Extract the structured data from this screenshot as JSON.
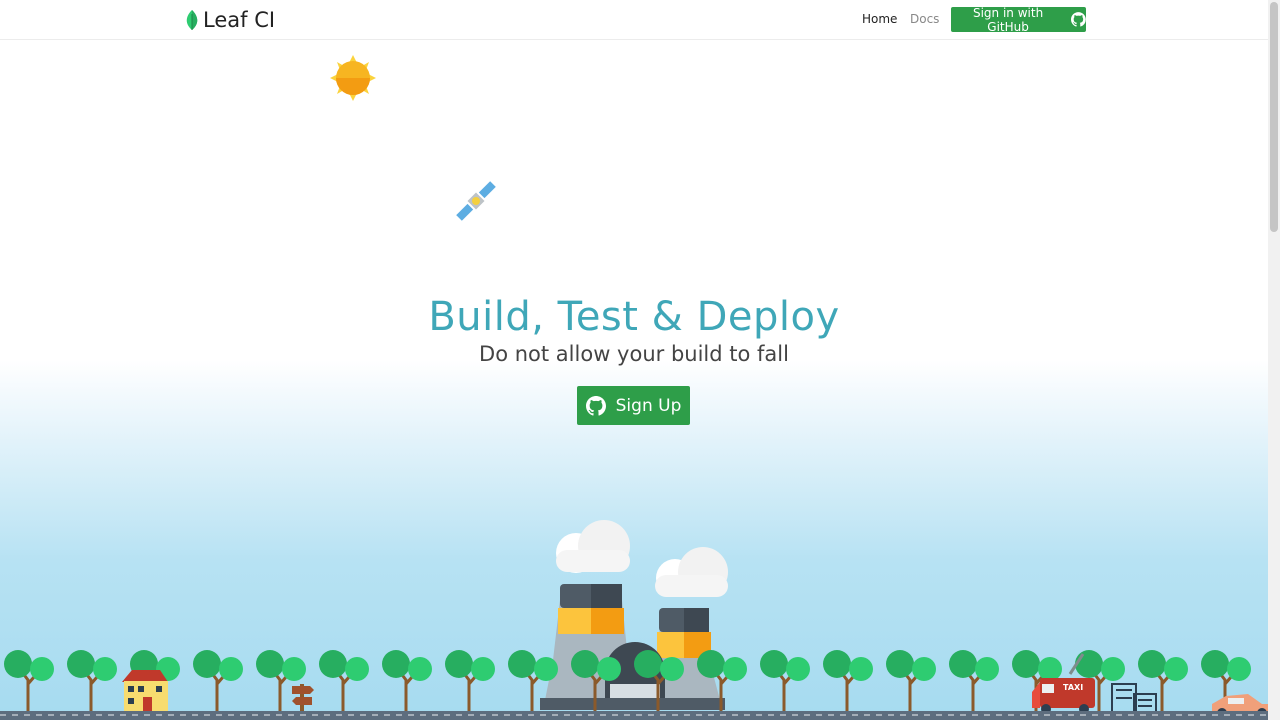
{
  "nav": {
    "brand": "Leaf CI",
    "home_label": "Home",
    "docs_label": "Docs",
    "signin_label": "Sign in with GitHub"
  },
  "hero": {
    "title": "Build, Test & Deploy",
    "subtitle": "Do not allow your build to fall",
    "signup_label": "Sign Up"
  },
  "scene": {
    "taxi_sign": "TAXI"
  },
  "colors": {
    "accent_green": "#2e9e49",
    "title_teal": "#3fa7b8",
    "sun": "#f7b521",
    "tree": "#2ec27e"
  }
}
